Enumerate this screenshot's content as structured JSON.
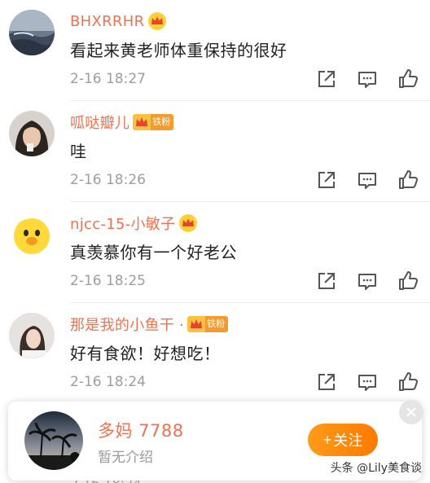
{
  "comments": [
    {
      "username": "BHXRRHR",
      "fan_badge": "",
      "text": "看起来黄老师体重保持的很好",
      "time": "2-16 18:27"
    },
    {
      "username": "呱哒瓣儿",
      "fan_badge": "铁粉",
      "text": "哇",
      "time": "2-16 18:26"
    },
    {
      "username": "njcc-15-小敏子",
      "fan_badge": "",
      "text": "真羡慕你有一个好老公",
      "time": "2-16 18:25"
    },
    {
      "username": "那是我的小鱼干 ·",
      "fan_badge": "铁粉",
      "text": "好有食欲！好想吃！",
      "time": "2-16 18:24"
    }
  ],
  "card": {
    "name": "多妈 7788",
    "bio": "暂无介绍",
    "follow_label": "关注",
    "follow_plus": "+"
  },
  "peek_time": "2-16 18:24",
  "watermark": "头条 @Lily美食谈",
  "colors": {
    "username": "#eb7350",
    "follow_button": "#ff8a00",
    "time": "#9d9d9d"
  }
}
